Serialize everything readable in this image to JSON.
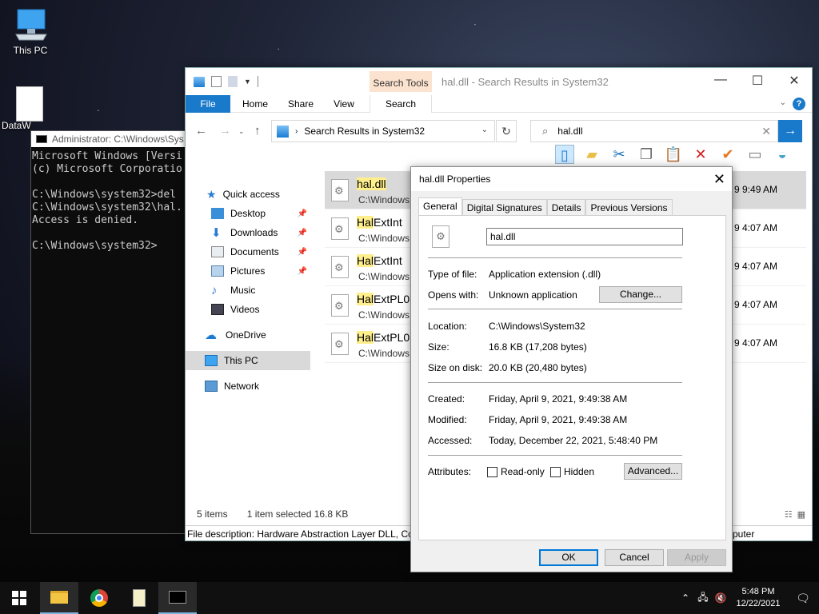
{
  "desktop": {
    "icons": [
      {
        "label": "This PC",
        "icon": "computer-icon"
      },
      {
        "label": "DataW",
        "icon": "document-icon"
      }
    ]
  },
  "console": {
    "title": "Administrator: C:\\Windows\\Sys",
    "lines": "Microsoft Windows [Versi\n(c) Microsoft Corporatio\n\nC:\\Windows\\system32>del\nC:\\Windows\\system32\\hal.\nAccess is denied.\n\nC:\\Windows\\system32>"
  },
  "explorer": {
    "context_tab": "Search Tools",
    "window_title": "hal.dll - Search Results in System32",
    "ribbon_tabs": [
      "File",
      "Home",
      "Share",
      "View",
      "Search"
    ],
    "address": "Search Results in System32",
    "search_value": "hal.dll",
    "nav": [
      {
        "label": "Quick access",
        "icon": "star-icon"
      },
      {
        "label": "Desktop",
        "icon": "desktop-icon"
      },
      {
        "label": "Downloads",
        "icon": "download-icon"
      },
      {
        "label": "Documents",
        "icon": "documents-icon"
      },
      {
        "label": "Pictures",
        "icon": "pictures-icon"
      },
      {
        "label": "Music",
        "icon": "music-icon"
      },
      {
        "label": "Videos",
        "icon": "videos-icon"
      },
      {
        "label": "OneDrive",
        "icon": "cloud-icon"
      },
      {
        "label": "This PC",
        "icon": "computer-icon"
      },
      {
        "label": "Network",
        "icon": "network-icon"
      }
    ],
    "results": [
      {
        "highlight": "hal.dll",
        "rest": "",
        "path": "C:\\Windows",
        "date": "9 9:49 AM"
      },
      {
        "highlight": "Hal",
        "rest": "ExtInt",
        "path": "C:\\Windows",
        "date": "9 4:07 AM"
      },
      {
        "highlight": "Hal",
        "rest": "ExtInt",
        "path": "C:\\Windows",
        "date": "9 4:07 AM"
      },
      {
        "highlight": "Hal",
        "rest": "ExtPL0",
        "path": "C:\\Windows",
        "date": "9 4:07 AM"
      },
      {
        "highlight": "Hal",
        "rest": "ExtPL0",
        "path": "C:\\Windows",
        "date": "9 4:07 AM"
      }
    ],
    "status": {
      "items": "5 items",
      "selected": "1 item selected  16.8 KB"
    },
    "description": "File description: Hardware Abstraction Layer DLL, Co",
    "description_tail": "puter"
  },
  "properties": {
    "title": "hal.dll Properties",
    "tabs": [
      "General",
      "Digital Signatures",
      "Details",
      "Previous Versions"
    ],
    "filename": "hal.dll",
    "type_label": "Type of file:",
    "type_value": "Application extension (.dll)",
    "opens_label": "Opens with:",
    "opens_value": "Unknown application",
    "change_button": "Change...",
    "location_label": "Location:",
    "location_value": "C:\\Windows\\System32",
    "size_label": "Size:",
    "size_value": "16.8 KB (17,208 bytes)",
    "disk_label": "Size on disk:",
    "disk_value": "20.0 KB (20,480 bytes)",
    "created_label": "Created:",
    "created_value": "Friday, April 9, 2021, 9:49:38 AM",
    "modified_label": "Modified:",
    "modified_value": "Friday, April 9, 2021, 9:49:38 AM",
    "accessed_label": "Accessed:",
    "accessed_value": "Today, December 22, 2021, 5:48:40 PM",
    "attributes_label": "Attributes:",
    "readonly_label": "Read-only",
    "hidden_label": "Hidden",
    "advanced_button": "Advanced...",
    "ok": "OK",
    "cancel": "Cancel",
    "apply": "Apply"
  },
  "taskbar": {
    "time": "5:48 PM",
    "date": "12/22/2021"
  }
}
